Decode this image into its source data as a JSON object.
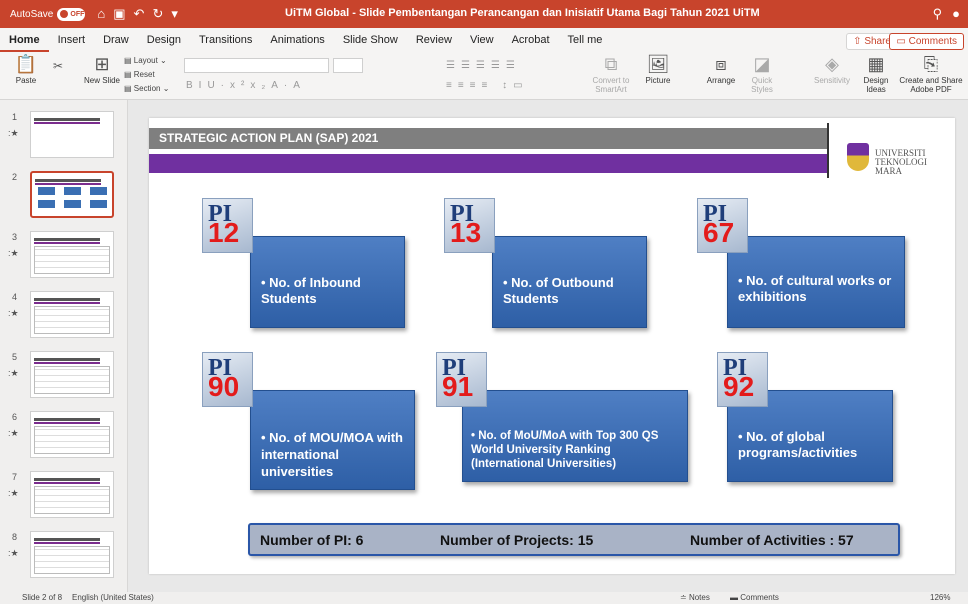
{
  "titlebar": {
    "autosave": "AutoSave",
    "toggle": "OFF",
    "title": "UiTM Global - Slide Pembentangan Perancangan dan Inisiatif Utama Bagi Tahun 2021 UiTM"
  },
  "tabs": [
    "Home",
    "Insert",
    "Draw",
    "Design",
    "Transitions",
    "Animations",
    "Slide Show",
    "Review",
    "View",
    "Acrobat",
    "Tell me"
  ],
  "share": "Share",
  "comments": "Comments",
  "ribbon": {
    "paste": "Paste",
    "new_slide": "New Slide",
    "layout": "Layout",
    "reset": "Reset",
    "section": "Section",
    "convert": "Convert to SmartArt",
    "picture": "Picture",
    "arrange": "Arrange",
    "quick_styles": "Quick Styles",
    "sensitivity": "Sensitivity",
    "design_ideas": "Design Ideas",
    "adobe": "Create and Share Adobe PDF"
  },
  "thumbs": [
    {
      "num": "1"
    },
    {
      "num": "2"
    },
    {
      "num": "3"
    },
    {
      "num": "4"
    },
    {
      "num": "5"
    },
    {
      "num": "6"
    },
    {
      "num": "7"
    },
    {
      "num": "8"
    }
  ],
  "slide": {
    "title": "STRATEGIC ACTION PLAN (SAP) 2021",
    "logo_line1": "UNIVERSITI",
    "logo_line2": "TEKNOLOGI",
    "logo_line3": "MARA",
    "pi_label": "PI",
    "items": [
      {
        "num": "12",
        "text": "• No. of Inbound Students"
      },
      {
        "num": "13",
        "text": "• No. of Outbound Students"
      },
      {
        "num": "67",
        "text": "• No. of cultural works or exhibitions"
      },
      {
        "num": "90",
        "text": "• No. of MOU/MOA with international universities"
      },
      {
        "num": "91",
        "text": "• No. of MoU/MoA with Top 300 QS World University Ranking (International Universities)"
      },
      {
        "num": "92",
        "text": "• No. of global programs/activities"
      }
    ],
    "summary": {
      "pi": "Number of PI: 6",
      "projects": "Number of Projects: 15",
      "activities": "Number of Activities : 57"
    }
  },
  "statusbar": {
    "slide": "Slide 2 of 8",
    "language": "English (United States)",
    "notes": "Notes",
    "comments": "Comments",
    "zoom": "126%"
  }
}
